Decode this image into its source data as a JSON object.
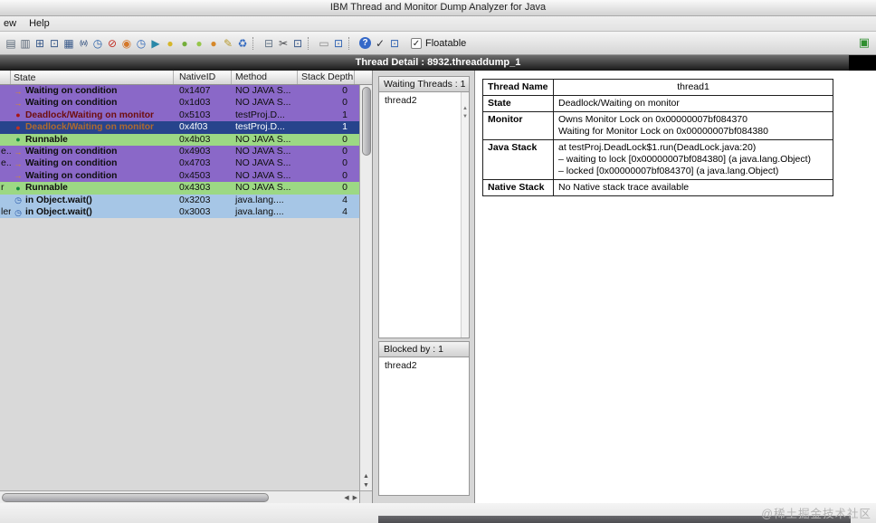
{
  "window": {
    "title": "IBM Thread and Monitor Dump Analyzer for Java",
    "menu": [
      "ew",
      "Help"
    ],
    "thread_detail_header": "Thread Detail : 8932.threaddump_1"
  },
  "toolbar": {
    "floatable_label": "Floatable",
    "checkbox_glyph": "✓",
    "expand_icon_glyph": "▣",
    "expand_icon_color": "#2f8f2f",
    "icons": [
      {
        "name": "open-file-icon",
        "glyph": "▤",
        "color": "#5a6878",
        "cls": "icon"
      },
      {
        "name": "save-file-icon",
        "glyph": "▥",
        "color": "#5a6878",
        "cls": "icon"
      },
      {
        "name": "summary-view-icon",
        "glyph": "⊞",
        "color": "#3a5a8a",
        "cls": "icon"
      },
      {
        "name": "monitor-view-icon",
        "glyph": "⊡",
        "color": "#3a5a8a",
        "cls": "icon"
      },
      {
        "name": "table-view-icon",
        "glyph": "▦",
        "color": "#3a5a8a",
        "cls": "icon"
      },
      {
        "name": "thread-view-icon",
        "glyph": "(w)",
        "color": "#2a4a7a",
        "cls": "small"
      },
      {
        "name": "clock-icon",
        "glyph": "◷",
        "color": "#2860a8",
        "cls": "icon"
      },
      {
        "name": "stop-icon",
        "glyph": "⊘",
        "color": "#c23026",
        "cls": "icon"
      },
      {
        "name": "record-icon",
        "glyph": "◉",
        "color": "#d4782a",
        "cls": "icon"
      },
      {
        "name": "history-clock-icon",
        "glyph": "◷",
        "color": "#3068b8",
        "cls": "icon"
      },
      {
        "name": "play-icon",
        "glyph": "▶",
        "color": "#2a88a8",
        "cls": "icon"
      },
      {
        "name": "yellow-ball-icon",
        "glyph": "●",
        "color": "#d6b62a",
        "cls": "icon"
      },
      {
        "name": "green-ball-icon",
        "glyph": "●",
        "color": "#74ae3a",
        "cls": "icon"
      },
      {
        "name": "lime-ball-icon",
        "glyph": "●",
        "color": "#96c64a",
        "cls": "icon"
      },
      {
        "name": "orange-ball-icon",
        "glyph": "●",
        "color": "#d6882a",
        "cls": "icon"
      },
      {
        "name": "pencil-icon",
        "glyph": "✎",
        "color": "#b89a2e",
        "cls": "icon"
      },
      {
        "name": "recycle-icon",
        "glyph": "♻",
        "color": "#3068c0",
        "cls": "icon"
      },
      {
        "name": "toolbar-separator",
        "glyph": "",
        "color": "",
        "cls": "sep"
      },
      {
        "name": "cube-icon",
        "glyph": "⊟",
        "color": "#68788a",
        "cls": "icon"
      },
      {
        "name": "scissors-icon",
        "glyph": "✂",
        "color": "#44464a",
        "cls": "icon"
      },
      {
        "name": "monitor-icon",
        "glyph": "⊡",
        "color": "#3a5a8a",
        "cls": "icon"
      },
      {
        "name": "toolbar-separator",
        "glyph": "",
        "color": "",
        "cls": "sep"
      },
      {
        "name": "minimize-icon",
        "glyph": "▭",
        "color": "#8a8a8a",
        "cls": "icon"
      },
      {
        "name": "window-icon",
        "glyph": "⊡",
        "color": "#3062b2",
        "cls": "icon"
      },
      {
        "name": "toolbar-separator",
        "glyph": "",
        "color": "",
        "cls": "sep"
      },
      {
        "name": "help-icon",
        "glyph": "?",
        "color": "#ffffff",
        "cls": "badge"
      },
      {
        "name": "check-icon",
        "glyph": "✓",
        "color": "#33343a",
        "cls": "icon"
      },
      {
        "name": "window-blue-icon",
        "glyph": "⊡",
        "color": "#3062b2",
        "cls": "icon"
      }
    ]
  },
  "thread_table": {
    "columns": [
      "",
      "State",
      "NativeID",
      "Method",
      "Stack Depth"
    ],
    "rows": [
      {
        "name": "",
        "state": "Waiting on condition",
        "native_id": "0x1407",
        "method": "NO JAVA S...",
        "depth": "0",
        "row_class": "waiting"
      },
      {
        "name": "",
        "state": "Waiting on condition",
        "native_id": "0x1d03",
        "method": "NO JAVA S...",
        "depth": "0",
        "row_class": "waiting"
      },
      {
        "name": "",
        "state": "Deadlock/Waiting on monitor",
        "native_id": "0x5103",
        "method": "testProj.D...",
        "depth": "1",
        "row_class": "deadlock"
      },
      {
        "name": "",
        "state": "Deadlock/Waiting on monitor",
        "native_id": "0x4f03",
        "method": "testProj.D...",
        "depth": "1",
        "row_class": "deadlock-selected"
      },
      {
        "name": "",
        "state": "Runnable",
        "native_id": "0x4b03",
        "method": "NO JAVA S...",
        "depth": "0",
        "row_class": "runnable"
      },
      {
        "name": "e...",
        "state": "Waiting on condition",
        "native_id": "0x4903",
        "method": "NO JAVA S...",
        "depth": "0",
        "row_class": "waiting"
      },
      {
        "name": "e...",
        "state": "Waiting on condition",
        "native_id": "0x4703",
        "method": "NO JAVA S...",
        "depth": "0",
        "row_class": "waiting"
      },
      {
        "name": "",
        "state": "Waiting on condition",
        "native_id": "0x4503",
        "method": "NO JAVA S...",
        "depth": "0",
        "row_class": "waiting"
      },
      {
        "name": "r",
        "state": "Runnable",
        "native_id": "0x4303",
        "method": "NO JAVA S...",
        "depth": "0",
        "row_class": "runnable"
      },
      {
        "name": "",
        "state": "in Object.wait()",
        "native_id": "0x3203",
        "method": "java.lang....",
        "depth": "4",
        "row_class": "objwait"
      },
      {
        "name": "ler",
        "state": "in Object.wait()",
        "native_id": "0x3003",
        "method": "java.lang....",
        "depth": "4",
        "row_class": "objwait"
      }
    ]
  },
  "waiting_panel": {
    "title": "Waiting Threads : 1",
    "items": [
      "thread2"
    ]
  },
  "blocked_panel": {
    "title": "Blocked by : 1",
    "items": [
      "thread2"
    ]
  },
  "detail_table": {
    "rows": [
      {
        "label": "Thread Name",
        "lines": [
          "thread1"
        ],
        "value_class": "center"
      },
      {
        "label": "State",
        "lines": [
          "Deadlock/Waiting on monitor"
        ],
        "value_class": ""
      },
      {
        "label": "Monitor",
        "lines": [
          "Owns Monitor Lock on 0x00000007bf084370",
          "Waiting for Monitor Lock on 0x00000007bf084380"
        ],
        "value_class": ""
      },
      {
        "label": "Java Stack",
        "lines": [
          "at testProj.DeadLock$1.run(DeadLock.java:20)",
          "– waiting to lock [0x00000007bf084380] (a java.lang.Object)",
          "– locked [0x00000007bf084370] (a java.lang.Object)"
        ],
        "value_class": ""
      },
      {
        "label": "Native Stack",
        "lines": [
          "No Native stack trace available"
        ],
        "value_class": ""
      }
    ]
  },
  "colors": {
    "waiting_row": "#8a68c8",
    "runnable_row": "#9cd884",
    "object_wait_row": "#a6c6e6",
    "selected_row": "#27448c",
    "deadlock_text": "#6e0d0d"
  },
  "watermark": "@稀土掘金技术社区"
}
